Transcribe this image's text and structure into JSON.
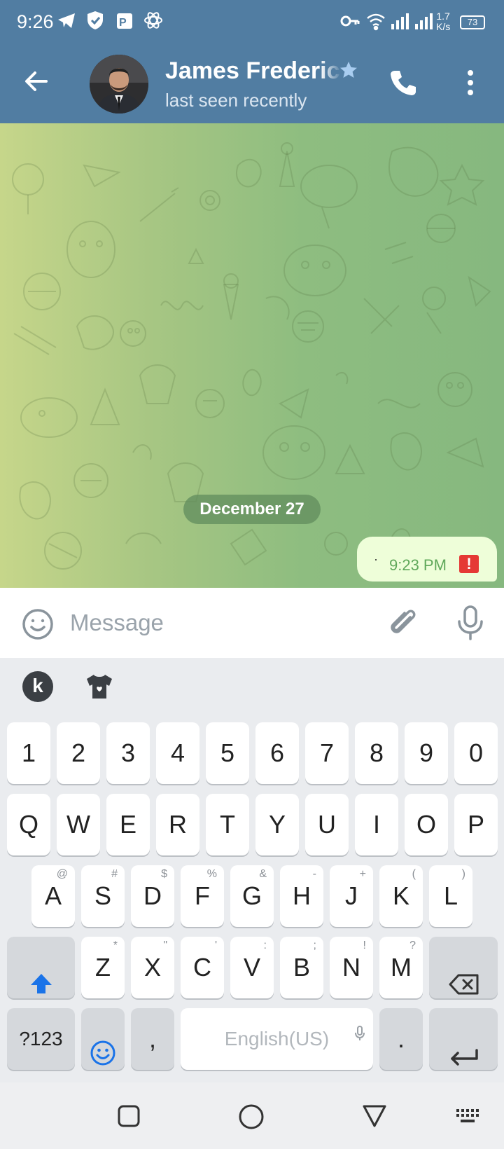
{
  "status_bar": {
    "time": "9:26",
    "speed": "1.7\nK/s",
    "speed_top": "1.7",
    "speed_bottom": "K/s",
    "battery": "73"
  },
  "header": {
    "contact_name": "James Frederic",
    "status": "last seen recently"
  },
  "chat": {
    "date_label": "December 27",
    "messages": [
      {
        "text": "·",
        "time": "9:23 PM",
        "status": "error"
      }
    ]
  },
  "input": {
    "placeholder": "Message",
    "value": ""
  },
  "keyboard": {
    "toolbar": {
      "k_label": "k"
    },
    "row_numbers": [
      "1",
      "2",
      "3",
      "4",
      "5",
      "6",
      "7",
      "8",
      "9",
      "0"
    ],
    "row_top": [
      "Q",
      "W",
      "E",
      "R",
      "T",
      "Y",
      "U",
      "I",
      "O",
      "P"
    ],
    "row_middle": [
      {
        "key": "A",
        "hint": "@"
      },
      {
        "key": "S",
        "hint": "#"
      },
      {
        "key": "D",
        "hint": "$"
      },
      {
        "key": "F",
        "hint": "%"
      },
      {
        "key": "G",
        "hint": "&"
      },
      {
        "key": "H",
        "hint": "-"
      },
      {
        "key": "J",
        "hint": "+"
      },
      {
        "key": "K",
        "hint": "("
      },
      {
        "key": "L",
        "hint": ")"
      }
    ],
    "row_bottom": [
      {
        "key": "Z",
        "hint": "*"
      },
      {
        "key": "X",
        "hint": "\""
      },
      {
        "key": "C",
        "hint": "'"
      },
      {
        "key": "V",
        "hint": ":"
      },
      {
        "key": "B",
        "hint": ";"
      },
      {
        "key": "N",
        "hint": "!"
      },
      {
        "key": "M",
        "hint": "?"
      }
    ],
    "symbols_label": "?123",
    "comma": ",",
    "space_label": "English(US)",
    "period": "."
  },
  "colors": {
    "header_bg": "#517da2",
    "bubble_bg": "#eefed9",
    "time_green": "#5fa85a",
    "error_red": "#e53935",
    "shift_blue": "#1a73e8"
  }
}
